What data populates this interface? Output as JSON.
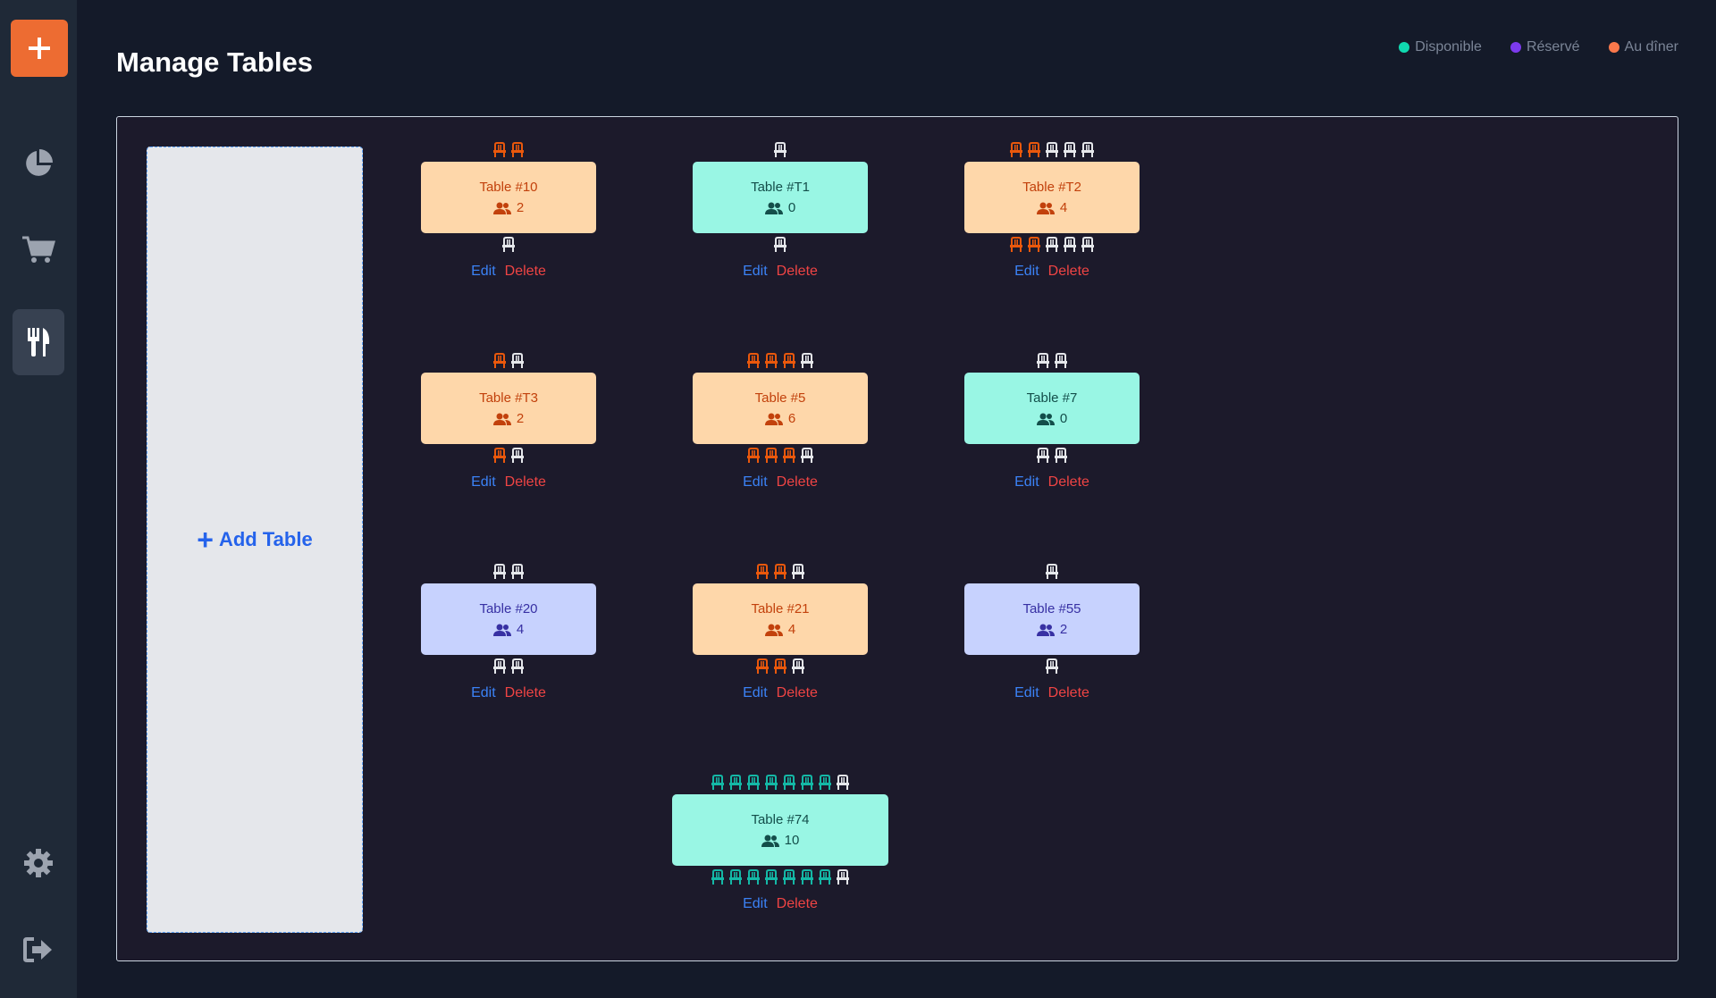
{
  "header": {
    "title": "Manage Tables"
  },
  "legend": [
    {
      "label": "Disponible",
      "color": "#10d9b0"
    },
    {
      "label": "Réservé",
      "color": "#7c3aed"
    },
    {
      "label": "Au dîner",
      "color": "#f9784b"
    }
  ],
  "sidebar": {
    "add_icon": "plus-icon",
    "items": [
      {
        "icon": "pie-chart-icon",
        "active": false
      },
      {
        "icon": "cart-icon",
        "active": false
      },
      {
        "icon": "utensils-icon",
        "active": true
      },
      {
        "icon": "gear-icon",
        "active": false
      },
      {
        "icon": "logout-icon",
        "active": false
      }
    ]
  },
  "add_table_label": "Add Table",
  "actions": {
    "edit": "Edit",
    "delete": "Delete"
  },
  "tables": [
    {
      "name": "Table #10",
      "guests": "2",
      "status": "orange",
      "top": [
        "o",
        "o"
      ],
      "bottom": [
        "w"
      ]
    },
    {
      "name": "Table #T1",
      "guests": "0",
      "status": "green",
      "top": [
        "w"
      ],
      "bottom": [
        "w"
      ]
    },
    {
      "name": "Table #T2",
      "guests": "4",
      "status": "orange",
      "top": [
        "o",
        "o",
        "w",
        "w",
        "w"
      ],
      "bottom": [
        "o",
        "o",
        "w",
        "w",
        "w"
      ]
    },
    {
      "name": "Table #T3",
      "guests": "2",
      "status": "orange",
      "top": [
        "o",
        "w"
      ],
      "bottom": [
        "o",
        "w"
      ]
    },
    {
      "name": "Table #5",
      "guests": "6",
      "status": "orange",
      "top": [
        "o",
        "o",
        "o",
        "w"
      ],
      "bottom": [
        "o",
        "o",
        "o",
        "w"
      ]
    },
    {
      "name": "Table #7",
      "guests": "0",
      "status": "green",
      "top": [
        "w",
        "w"
      ],
      "bottom": [
        "w",
        "w"
      ]
    },
    {
      "name": "Table #20",
      "guests": "4",
      "status": "blue",
      "top": [
        "w",
        "w"
      ],
      "bottom": [
        "w",
        "w"
      ]
    },
    {
      "name": "Table #21",
      "guests": "4",
      "status": "orange",
      "top": [
        "o",
        "o",
        "w"
      ],
      "bottom": [
        "o",
        "o",
        "w"
      ]
    },
    {
      "name": "Table #55",
      "guests": "2",
      "status": "blue",
      "top": [
        "w"
      ],
      "bottom": [
        "w"
      ]
    },
    {
      "name": "Table #74",
      "guests": "10",
      "status": "green",
      "top": [
        "g",
        "g",
        "g",
        "g",
        "g",
        "g",
        "g",
        "w"
      ],
      "bottom": [
        "g",
        "g",
        "g",
        "g",
        "g",
        "g",
        "g",
        "w"
      ]
    }
  ],
  "chair_colors": {
    "o": "#ea580c",
    "w": "#e5e7eb",
    "g": "#14b8a6"
  }
}
